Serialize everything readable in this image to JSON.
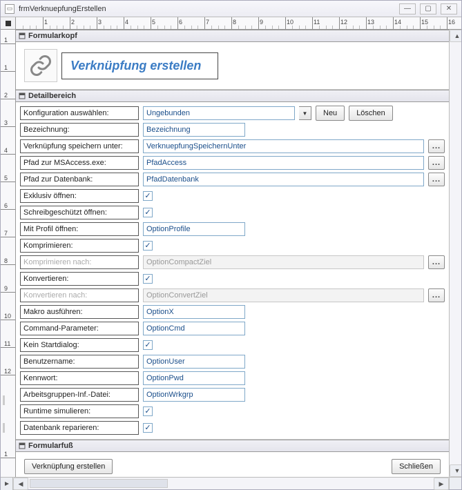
{
  "window": {
    "title": "frmVerknuepfungErstellen"
  },
  "ruler_h_max": 16,
  "ruler_v": [
    "1",
    "1",
    "2",
    "3",
    "4",
    "5",
    "6",
    "7",
    "8",
    "9",
    "10",
    "11",
    "12",
    "-",
    "-",
    "1"
  ],
  "sections": {
    "header": "Formularkopf",
    "detail": "Detailbereich",
    "footer": "Formularfuß"
  },
  "form_header": {
    "title": "Verknüpfung erstellen"
  },
  "detail": {
    "config_select_label": "Konfiguration auswählen:",
    "config_select_value": "Ungebunden",
    "btn_new": "Neu",
    "btn_delete": "Löschen",
    "rows": [
      {
        "label": "Bezeichnung:",
        "value": "Bezeichnung",
        "type": "text",
        "width": "w-text"
      },
      {
        "label": "Verknüpfung speichern unter:",
        "value": "VerknuepfungSpeichernUnter",
        "type": "browse",
        "width": "w-wide"
      },
      {
        "label": "Pfad zur MSAccess.exe:",
        "value": "PfadAccess",
        "type": "browse",
        "width": "w-wide"
      },
      {
        "label": "Pfad zur Datenbank:",
        "value": "PfadDatenbank",
        "type": "browse",
        "width": "w-wide"
      },
      {
        "label": "Exklusiv öffnen:",
        "type": "check",
        "checked": true
      },
      {
        "label": "Schreibgeschützt öffnen:",
        "type": "check",
        "checked": true
      },
      {
        "label": "Mit Profil öffnen:",
        "value": "OptionProfile",
        "type": "text",
        "width": "w-text"
      },
      {
        "label": "Komprimieren:",
        "type": "check",
        "checked": true
      },
      {
        "label": "Komprimieren nach:",
        "value": "OptionCompactZiel",
        "type": "browse",
        "width": "w-wide",
        "disabled": true
      },
      {
        "label": "Konvertieren:",
        "type": "check",
        "checked": true
      },
      {
        "label": "Konvertieren nach:",
        "value": "OptionConvertZiel",
        "type": "browse",
        "width": "w-wide",
        "disabled": true
      },
      {
        "label": "Makro ausführen:",
        "value": "OptionX",
        "type": "text",
        "width": "w-text"
      },
      {
        "label": "Command-Parameter:",
        "value": "OptionCmd",
        "type": "text",
        "width": "w-text"
      },
      {
        "label": "Kein Startdialog:",
        "type": "check",
        "checked": true
      },
      {
        "label": "Benutzername:",
        "value": "OptionUser",
        "type": "text",
        "width": "w-text"
      },
      {
        "label": "Kennwort:",
        "value": "OptionPwd",
        "type": "text",
        "width": "w-text"
      },
      {
        "label": "Arbeitsgruppen-Inf.-Datei:",
        "value": "OptionWrkgrp",
        "type": "text",
        "width": "w-text"
      },
      {
        "label": "Runtime simulieren:",
        "type": "check",
        "checked": true
      },
      {
        "label": "Datenbank reparieren:",
        "type": "check",
        "checked": true
      }
    ]
  },
  "footer": {
    "btn_create": "Verknüpfung erstellen",
    "btn_close": "Schließen"
  },
  "browse_glyph": "..."
}
